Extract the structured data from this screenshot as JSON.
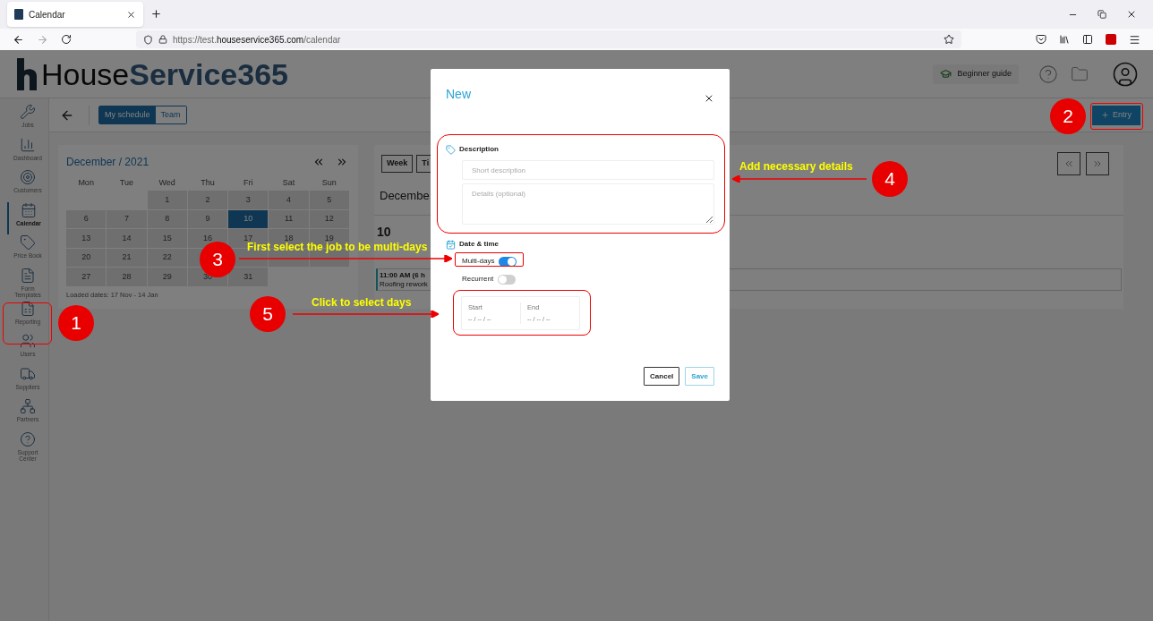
{
  "browser": {
    "tab_title": "Calendar",
    "url_prefix": "https://test.",
    "url_domain": "houseservice365.com",
    "url_path": "/calendar"
  },
  "header": {
    "logo_first": "House",
    "logo_second": "Service365",
    "guide_button": "Beginner guide"
  },
  "sidebar": {
    "items": [
      {
        "label": "Jobs",
        "selected": false
      },
      {
        "label": "Dashboard",
        "selected": false
      },
      {
        "label": "Customers",
        "selected": false
      },
      {
        "label": "Calendar",
        "selected": true
      },
      {
        "label": "Price Book",
        "selected": false
      },
      {
        "label": "Form Templates",
        "selected": false
      },
      {
        "label": "Reporting",
        "selected": false
      },
      {
        "label": "Users",
        "selected": false
      },
      {
        "label": "Suppliers",
        "selected": false
      },
      {
        "label": "Partners",
        "selected": false
      },
      {
        "label": "Support Center",
        "selected": false
      }
    ]
  },
  "toolbar": {
    "segments": [
      {
        "label": "My schedule",
        "selected": true
      },
      {
        "label": "Team",
        "selected": false
      }
    ],
    "entry_button": "Entry"
  },
  "mini_calendar": {
    "title": "December / 2021",
    "weekdays": [
      "Mon",
      "Tue",
      "Wed",
      "Thu",
      "Fri",
      "Sat",
      "Sun"
    ],
    "weeks": [
      [
        {
          "day": "1",
          "selected": false
        },
        {
          "day": "2",
          "selected": false
        },
        {
          "day": "3",
          "selected": false
        },
        {
          "day": "4",
          "selected": false
        },
        {
          "day": "5",
          "selected": false
        }
      ],
      [
        {
          "day": "6",
          "selected": false
        },
        {
          "day": "7",
          "selected": false
        },
        {
          "day": "8",
          "selected": false
        },
        {
          "day": "9",
          "selected": false
        },
        {
          "day": "10",
          "selected": true
        },
        {
          "day": "11",
          "selected": false
        },
        {
          "day": "12",
          "selected": false
        }
      ],
      [
        {
          "day": "13",
          "selected": false
        },
        {
          "day": "14",
          "selected": false
        },
        {
          "day": "15",
          "selected": false
        },
        {
          "day": "16",
          "selected": false
        },
        {
          "day": "17",
          "selected": false
        },
        {
          "day": "18",
          "selected": false
        },
        {
          "day": "19",
          "selected": false
        }
      ],
      [
        {
          "day": "20",
          "selected": false
        },
        {
          "day": "21",
          "selected": false
        },
        {
          "day": "22",
          "selected": false
        },
        {
          "selected": false
        },
        {
          "selected": false
        },
        {
          "selected": false
        },
        {
          "selected": false
        }
      ],
      [
        {
          "day": "27",
          "selected": false
        },
        {
          "day": "28",
          "selected": false
        },
        {
          "day": "29",
          "selected": false
        },
        {
          "day": "30",
          "selected": false
        },
        {
          "day": "31",
          "selected": false
        }
      ]
    ],
    "footer": "Loaded dates: 17 Nov - 14 Jan"
  },
  "day_view": {
    "view_buttons": [
      "Week",
      "Ti"
    ],
    "heading": "Decembe",
    "day": "10",
    "event": {
      "time": "11:00 AM (6 h",
      "title": "Roofing rework"
    }
  },
  "dialog": {
    "title": "New",
    "description_label": "Description",
    "short_placeholder": "Short description",
    "details_placeholder": "Details (optional)",
    "date_label": "Date & time",
    "toggles": [
      {
        "label": "Multi-days",
        "on": true
      },
      {
        "label": "Recurrent",
        "on": false
      }
    ],
    "range": [
      {
        "label": "Start",
        "value": "-- / -- / --"
      },
      {
        "label": "End",
        "value": "-- / -- / --"
      }
    ],
    "cancel": "Cancel",
    "save": "Save"
  },
  "annotations": [
    {
      "kind": "badge",
      "label": "1"
    },
    {
      "kind": "badge",
      "label": "2"
    },
    {
      "kind": "badge",
      "label": "3"
    },
    {
      "kind": "note",
      "text": "First select the job to be multi-days"
    },
    {
      "kind": "badge",
      "label": "4"
    },
    {
      "kind": "note",
      "text": "Add necessary details"
    },
    {
      "kind": "badge",
      "label": "5"
    },
    {
      "kind": "note",
      "text": "Click to select days"
    }
  ]
}
